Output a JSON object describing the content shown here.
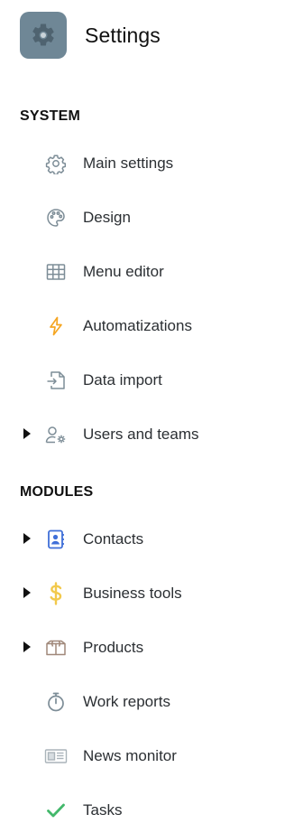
{
  "header": {
    "title": "Settings",
    "logo_icon": "gear-icon"
  },
  "sections": [
    {
      "title": "SYSTEM",
      "items": [
        {
          "label": "Main settings",
          "icon": "gear-icon",
          "expandable": false
        },
        {
          "label": "Design",
          "icon": "palette-icon",
          "expandable": false
        },
        {
          "label": "Menu editor",
          "icon": "grid-icon",
          "expandable": false
        },
        {
          "label": "Automatizations",
          "icon": "lightning-icon",
          "expandable": false
        },
        {
          "label": "Data import",
          "icon": "file-import-icon",
          "expandable": false
        },
        {
          "label": "Users and teams",
          "icon": "user-gear-icon",
          "expandable": true
        }
      ]
    },
    {
      "title": "MODULES",
      "items": [
        {
          "label": "Contacts",
          "icon": "address-book-icon",
          "expandable": true
        },
        {
          "label": "Business tools",
          "icon": "dollar-icon",
          "expandable": true
        },
        {
          "label": "Products",
          "icon": "box-icon",
          "expandable": true
        },
        {
          "label": "Work reports",
          "icon": "stopwatch-icon",
          "expandable": false
        },
        {
          "label": "News monitor",
          "icon": "newspaper-icon",
          "expandable": false
        },
        {
          "label": "Tasks",
          "icon": "checkmark-icon",
          "expandable": false
        }
      ]
    }
  ],
  "colors": {
    "logo_bg": "#6f8796",
    "icon_gray": "#7d8d97",
    "lightning": "#f5a623",
    "contacts_blue": "#3f6fd8",
    "dollar_yellow": "#f2c94c",
    "box_brown": "#a0887a",
    "check_green": "#43b86b"
  }
}
